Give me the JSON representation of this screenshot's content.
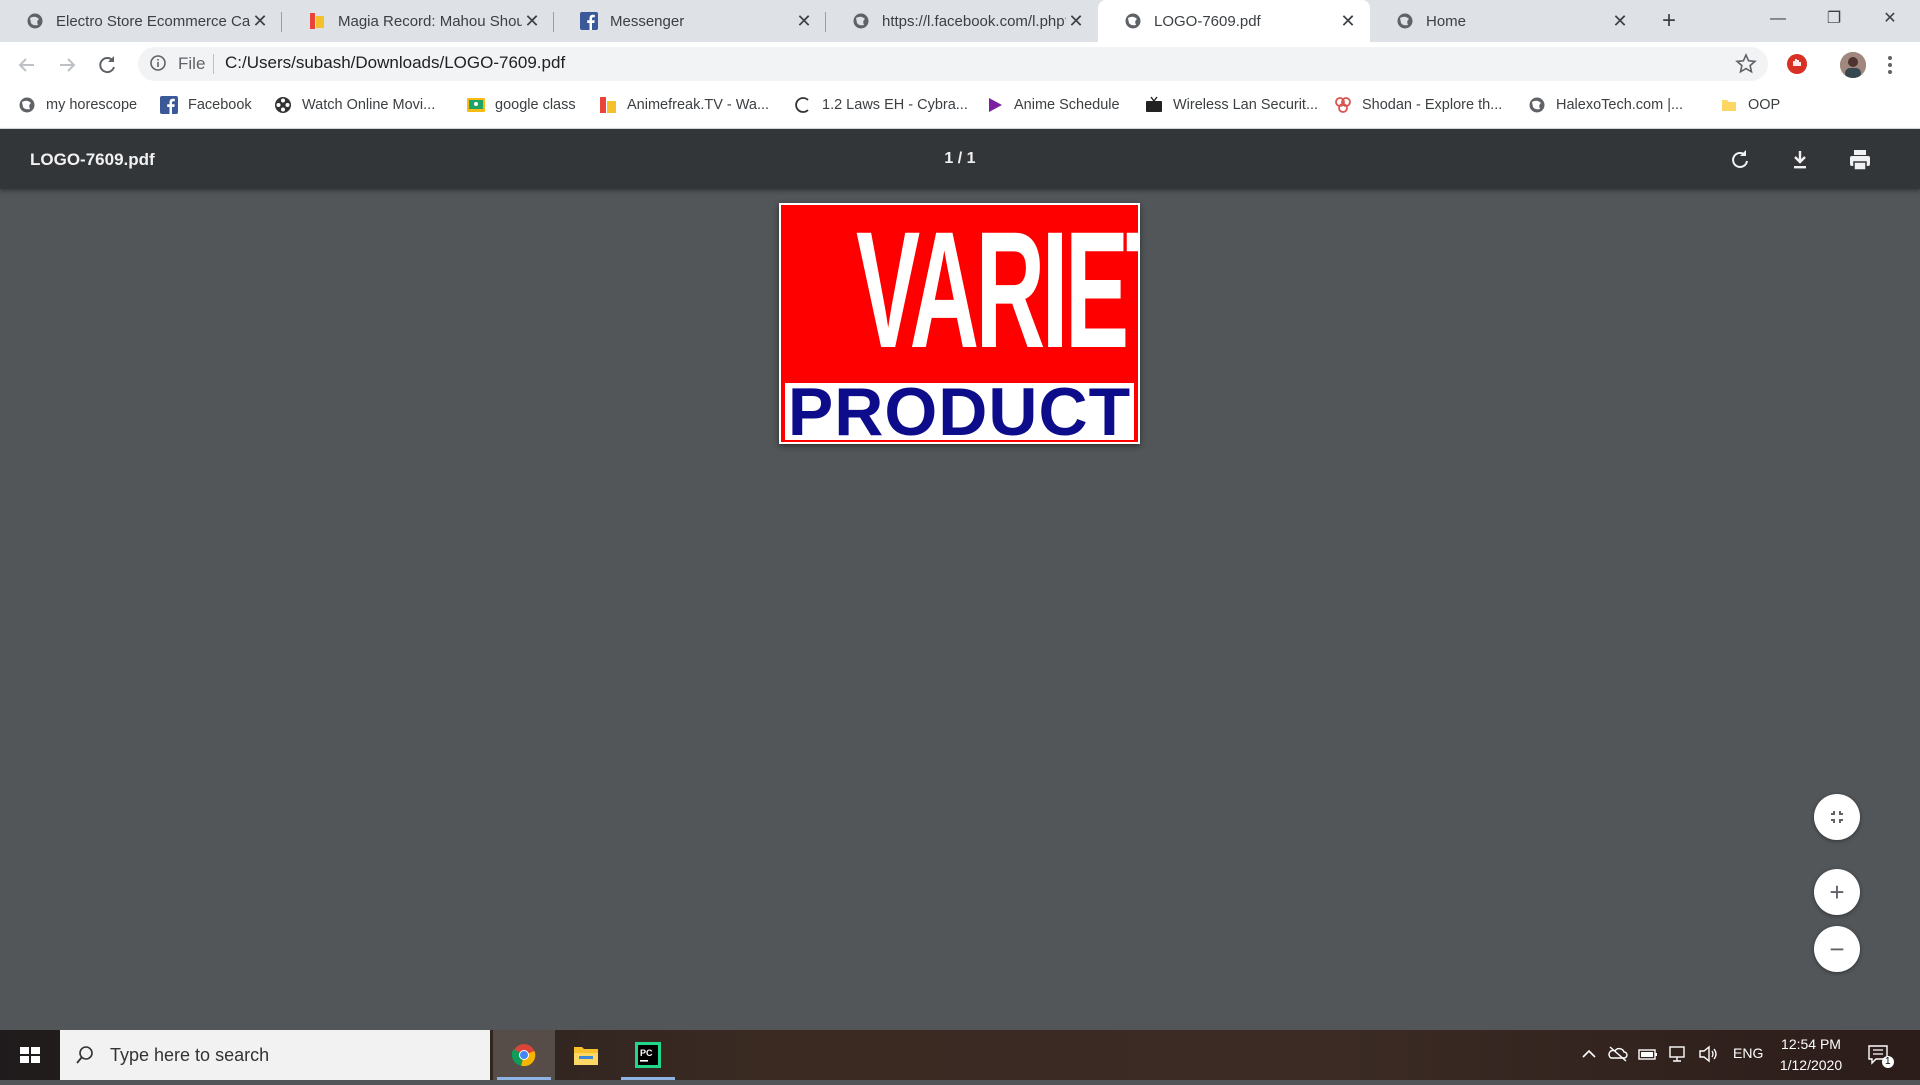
{
  "tabs": [
    {
      "title": "Electro Store Ecommerce Category Bootstrap",
      "icon": "globe-icon"
    },
    {
      "title": "Magia Record: Mahou Shoujo",
      "icon": "magia-favicon"
    },
    {
      "title": "Messenger",
      "icon": "facebook-icon"
    },
    {
      "title": "https://l.facebook.com/l.php?u=",
      "icon": "globe-icon"
    },
    {
      "title": "LOGO-7609.pdf",
      "icon": "globe-icon",
      "active": true
    },
    {
      "title": "Home",
      "icon": "globe-icon"
    }
  ],
  "tab_close": "✕",
  "new_tab": "+",
  "window": {
    "minimize": "—",
    "restore": "❐",
    "close": "✕"
  },
  "omnibox": {
    "scheme_label": "File",
    "url": "C:/Users/subash/Downloads/LOGO-7609.pdf"
  },
  "bookmarks": [
    {
      "label": "my horescope",
      "icon": "globe-icon"
    },
    {
      "label": "Facebook",
      "icon": "facebook-icon"
    },
    {
      "label": "Watch Online Movi...",
      "icon": "film-reel-icon"
    },
    {
      "label": "google class",
      "icon": "classroom-icon"
    },
    {
      "label": "Animefreak.TV - Wa...",
      "icon": "animefreak-icon"
    },
    {
      "label": "1.2 Laws EH - Cybra...",
      "icon": "cybrary-icon"
    },
    {
      "label": "Anime Schedule",
      "icon": "play-icon"
    },
    {
      "label": "Wireless Lan Securit...",
      "icon": "tv-icon"
    },
    {
      "label": "Shodan - Explore th...",
      "icon": "shodan-icon"
    },
    {
      "label": "HalexoTech.com |...",
      "icon": "globe-icon"
    },
    {
      "label": "OOP",
      "icon": "folder-icon"
    }
  ],
  "pdf": {
    "title": "LOGO-7609.pdf",
    "page_indicator": "1 / 1"
  },
  "logo": {
    "top_text": "VARIETY",
    "bottom_text": "PRODUCT"
  },
  "zoom": {
    "fit": "fit-icon",
    "in": "+",
    "out": "−"
  },
  "taskbar": {
    "search_placeholder": "Type here to search",
    "apps": [
      "chrome",
      "file-explorer",
      "pycharm"
    ],
    "lang": "ENG",
    "time": "12:54 PM",
    "date": "1/12/2020",
    "notification_count": "1"
  },
  "colors": {
    "logo_red": "#ff0000",
    "logo_blue": "#0d0c8a",
    "pdf_bg": "#525659",
    "pdf_bar": "#323639"
  }
}
